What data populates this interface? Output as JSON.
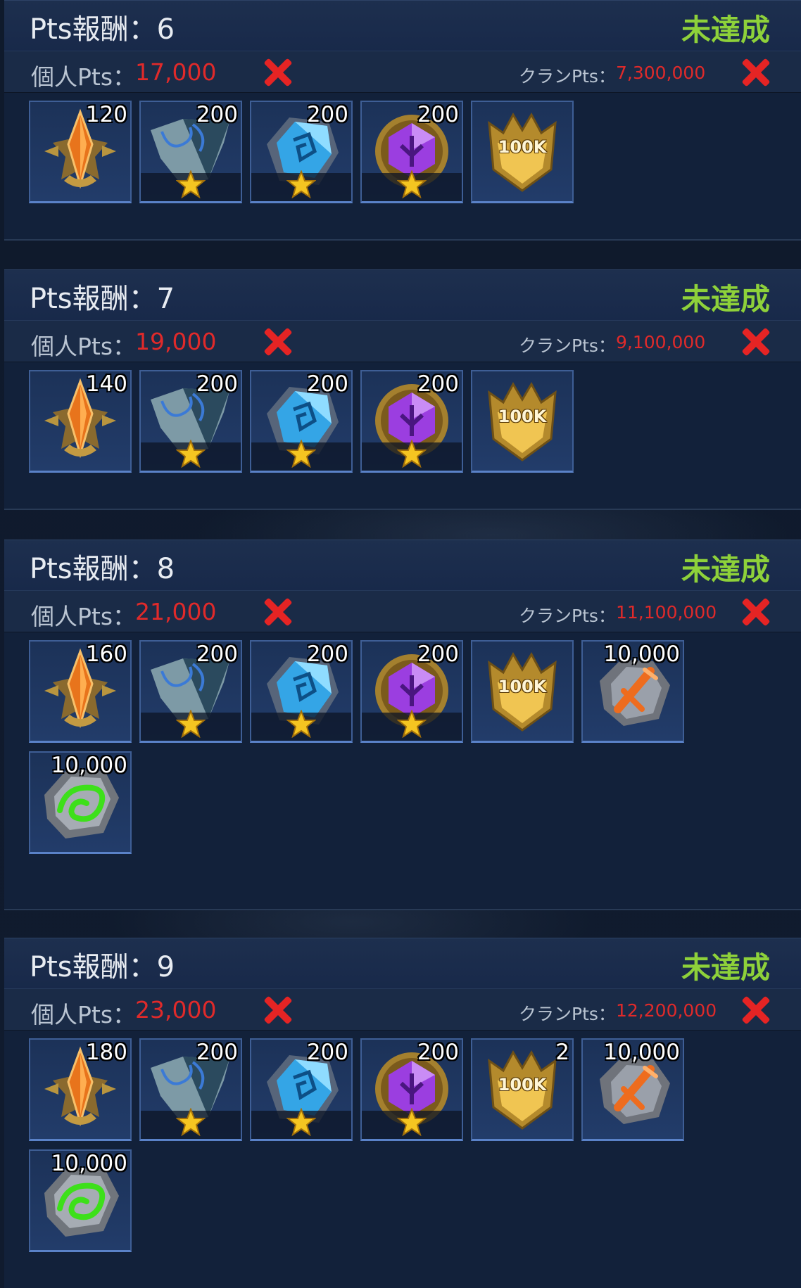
{
  "sections": [
    {
      "title": "Pts報酬：6",
      "status": "未達成",
      "personal_label": "個人Pts：",
      "personal_value": "17,000",
      "clan_label": "クランPts：",
      "clan_value": "7,300,000",
      "items": [
        {
          "icon": "orange-crest-icon",
          "qty": "120",
          "star": false
        },
        {
          "icon": "slate-fragment-icon",
          "qty": "200",
          "star": true
        },
        {
          "icon": "blue-rune-stone-icon",
          "qty": "200",
          "star": true
        },
        {
          "icon": "purple-gem-icon",
          "qty": "200",
          "star": true
        },
        {
          "icon": "gold-100k-badge-icon",
          "qty": "",
          "star": false,
          "label": "100K"
        }
      ]
    },
    {
      "title": "Pts報酬：7",
      "status": "未達成",
      "personal_label": "個人Pts：",
      "personal_value": "19,000",
      "clan_label": "クランPts：",
      "clan_value": "9,100,000",
      "items": [
        {
          "icon": "orange-crest-icon",
          "qty": "140",
          "star": false
        },
        {
          "icon": "slate-fragment-icon",
          "qty": "200",
          "star": true
        },
        {
          "icon": "blue-rune-stone-icon",
          "qty": "200",
          "star": true
        },
        {
          "icon": "purple-gem-icon",
          "qty": "200",
          "star": true
        },
        {
          "icon": "gold-100k-badge-icon",
          "qty": "",
          "star": false,
          "label": "100K"
        }
      ]
    },
    {
      "title": "Pts報酬：8",
      "status": "未達成",
      "personal_label": "個人Pts：",
      "personal_value": "21,000",
      "clan_label": "クランPts：",
      "clan_value": "11,100,000",
      "items": [
        {
          "icon": "orange-crest-icon",
          "qty": "160",
          "star": false
        },
        {
          "icon": "slate-fragment-icon",
          "qty": "200",
          "star": true
        },
        {
          "icon": "blue-rune-stone-icon",
          "qty": "200",
          "star": true
        },
        {
          "icon": "purple-gem-icon",
          "qty": "200",
          "star": true
        },
        {
          "icon": "gold-100k-badge-icon",
          "qty": "",
          "star": false,
          "label": "100K"
        },
        {
          "icon": "orange-sword-ore-icon",
          "qty": "10,000",
          "star": false
        },
        {
          "icon": "green-rune-ore-icon",
          "qty": "10,000",
          "star": false
        }
      ]
    },
    {
      "title": "Pts報酬：9",
      "status": "未達成",
      "personal_label": "個人Pts：",
      "personal_value": "23,000",
      "clan_label": "クランPts：",
      "clan_value": "12,200,000",
      "items": [
        {
          "icon": "orange-crest-icon",
          "qty": "180",
          "star": false
        },
        {
          "icon": "slate-fragment-icon",
          "qty": "200",
          "star": true
        },
        {
          "icon": "blue-rune-stone-icon",
          "qty": "200",
          "star": true
        },
        {
          "icon": "purple-gem-icon",
          "qty": "200",
          "star": true
        },
        {
          "icon": "gold-100k-badge-icon",
          "qty": "2",
          "star": false,
          "label": "100K"
        },
        {
          "icon": "orange-sword-ore-icon",
          "qty": "10,000",
          "star": false
        },
        {
          "icon": "green-rune-ore-icon",
          "qty": "10,000",
          "star": false
        }
      ]
    }
  ],
  "colors": {
    "status_green": "#8ed13a",
    "points_red": "#e02a2a",
    "header_bg": "#1d2f4e"
  }
}
